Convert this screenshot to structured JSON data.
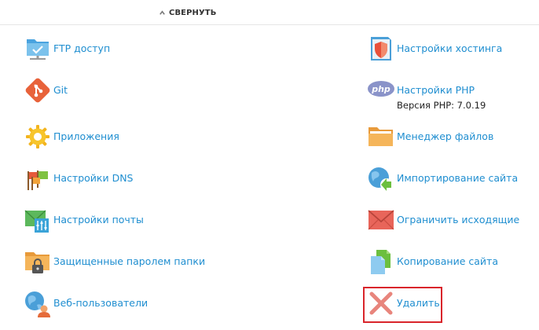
{
  "collapse": {
    "label": "СВЕРНУТЬ"
  },
  "left": [
    {
      "label": "FTP доступ",
      "icon": "ftp-folder-icon"
    },
    {
      "label": "Git",
      "icon": "git-icon"
    },
    {
      "label": "Приложения",
      "icon": "gear-icon"
    },
    {
      "label": "Настройки DNS",
      "icon": "dns-flags-icon"
    },
    {
      "label": "Настройки почты",
      "icon": "mail-settings-icon"
    },
    {
      "label": "Защищенные паролем папки",
      "icon": "locked-folder-icon"
    },
    {
      "label": "Веб-пользователи",
      "icon": "web-user-icon"
    }
  ],
  "right": [
    {
      "label": "Настройки хостинга",
      "icon": "hosting-settings-icon"
    },
    {
      "label": "Настройки PHP",
      "sublabel": "Версия PHP: 7.0.19",
      "icon": "php-icon",
      "icon_text": "php"
    },
    {
      "label": "Менеджер файлов",
      "icon": "file-manager-folder-icon"
    },
    {
      "label": "Импортирование сайта",
      "icon": "import-site-icon"
    },
    {
      "label": "Ограничить исходящие",
      "icon": "limit-outgoing-mail-icon"
    },
    {
      "label": "Копирование сайта",
      "icon": "copy-site-icon"
    },
    {
      "label": "Удалить",
      "icon": "delete-x-icon"
    }
  ],
  "colors": {
    "link": "#1f8ed0",
    "highlight_border": "#d9252b",
    "delete_icon": "#e8857c"
  }
}
